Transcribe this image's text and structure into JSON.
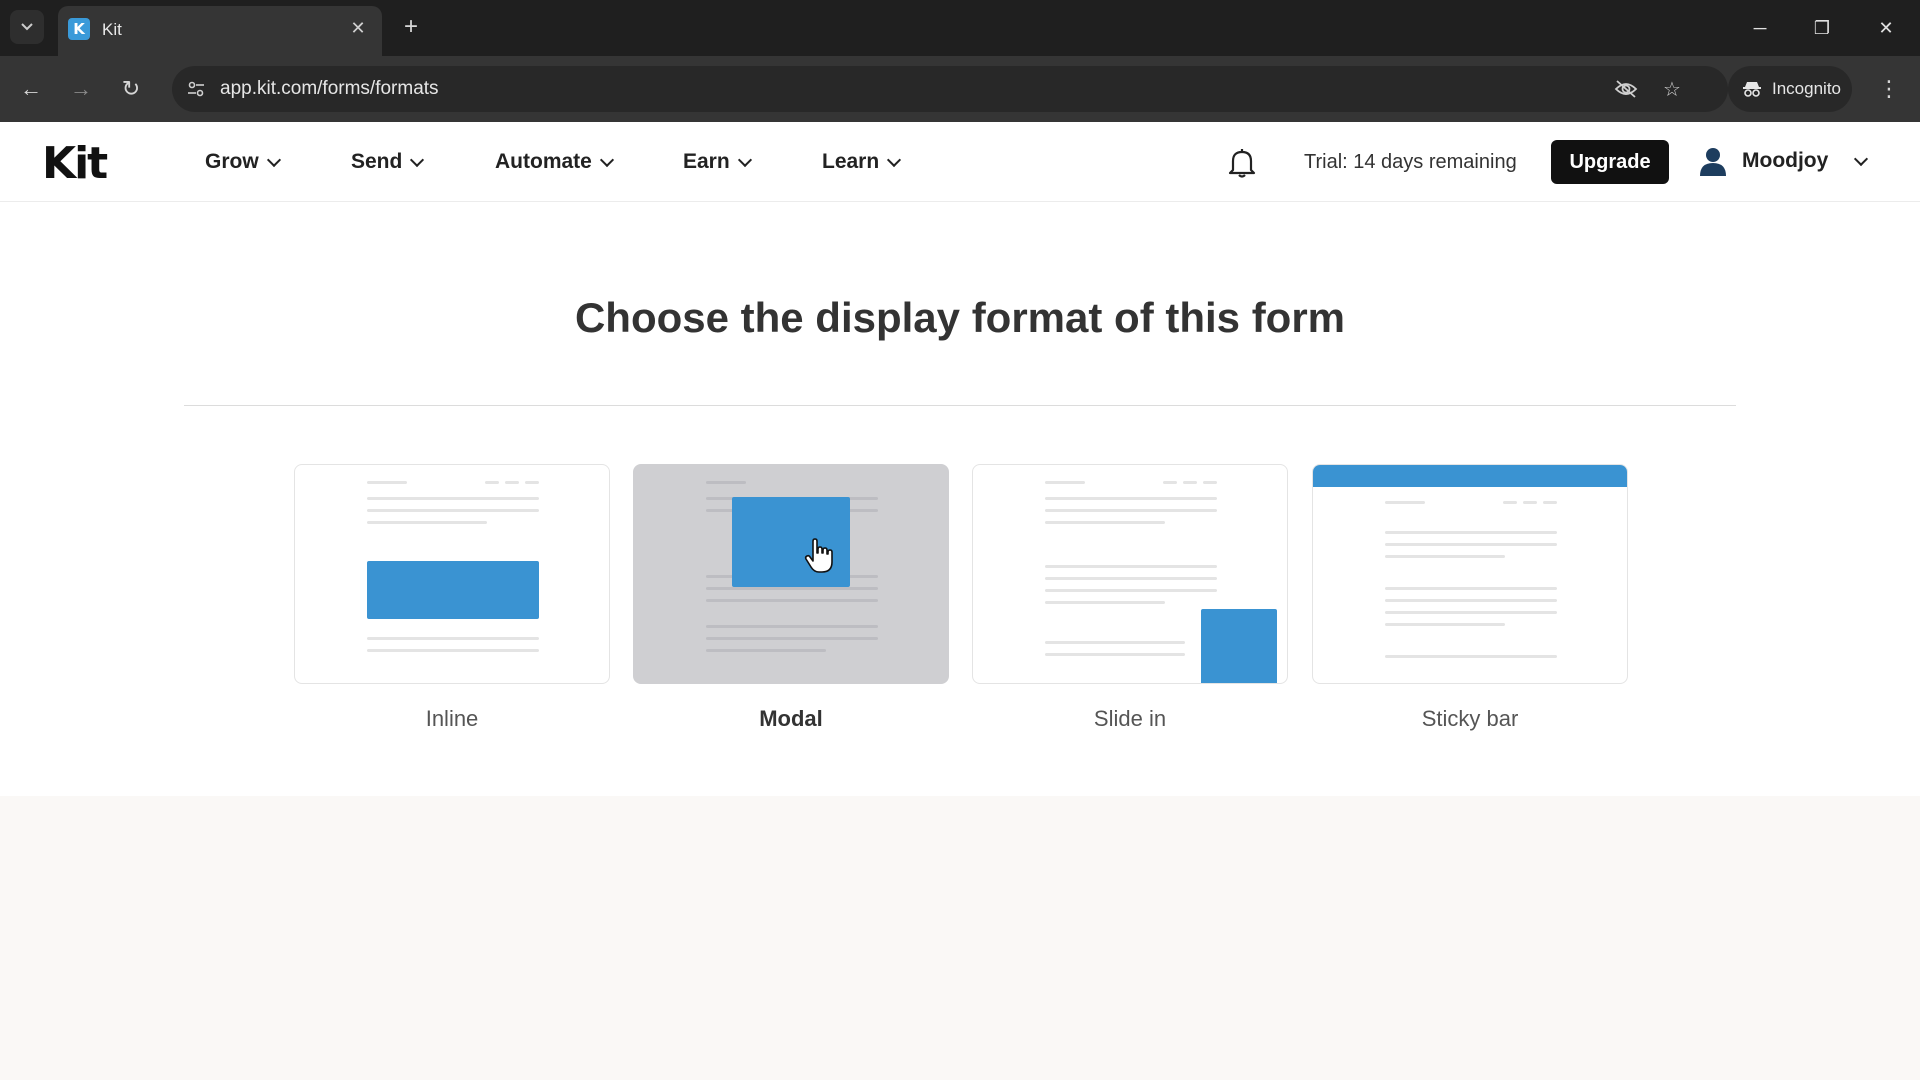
{
  "browser": {
    "tab_title": "Kit",
    "favicon_letter": "K",
    "url": "app.kit.com/forms/formats",
    "incognito_label": "Incognito"
  },
  "header": {
    "logo": "Kit",
    "menu": [
      {
        "label": "Grow"
      },
      {
        "label": "Send"
      },
      {
        "label": "Automate"
      },
      {
        "label": "Earn"
      },
      {
        "label": "Learn"
      }
    ],
    "trial_text": "Trial: 14 days remaining",
    "upgrade_label": "Upgrade",
    "user_name": "Moodjoy"
  },
  "main": {
    "title": "Choose the display format of this form",
    "formats": [
      {
        "label": "Inline",
        "selected": false
      },
      {
        "label": "Modal",
        "selected": true
      },
      {
        "label": "Slide in",
        "selected": false
      },
      {
        "label": "Sticky bar",
        "selected": false
      }
    ]
  },
  "colors": {
    "accent_blue": "#3a93d2",
    "upgrade_bg": "#111111"
  }
}
